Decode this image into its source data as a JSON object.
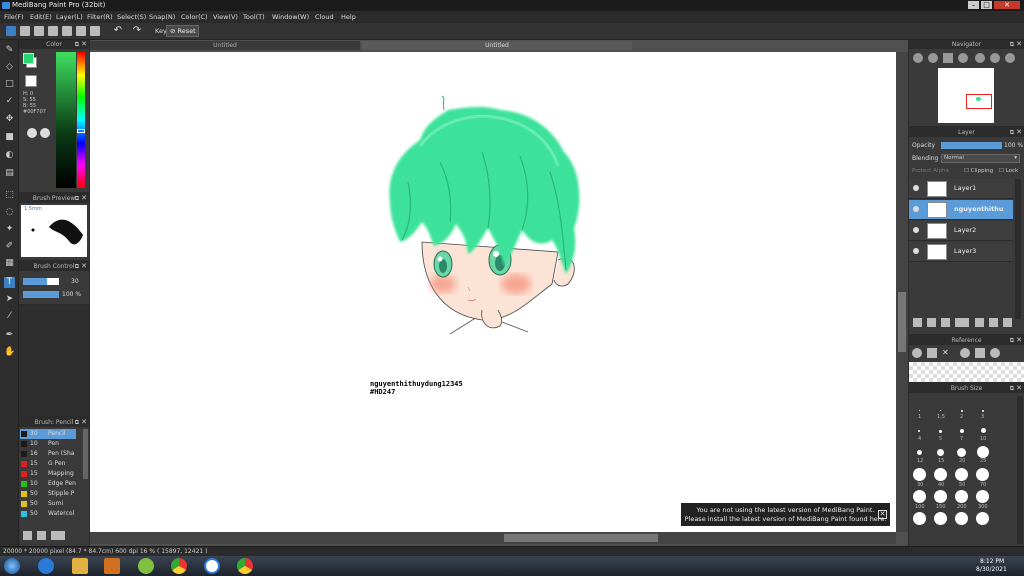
{
  "app_title": "MediBang Paint Pro (32bit)",
  "window_controls": [
    "–",
    "□",
    "✕"
  ],
  "menu": [
    "File(F)",
    "Edit(E)",
    "Layer(L)",
    "Filter(R)",
    "Select(S)",
    "Snap(N)",
    "Color(C)",
    "View(V)",
    "Tool(T)",
    "Window(W)",
    "Cloud",
    "Help"
  ],
  "toolbar": {
    "key_label": "Key",
    "reset_label": "Reset"
  },
  "doc_tabs": [
    "Untitled",
    "Untitled"
  ],
  "color_panel": {
    "title": "Color",
    "values": [
      "H: 0",
      "S: 55",
      "B: 55",
      "#00F707"
    ],
    "fg": "#26d96f",
    "bg": "#ffffff"
  },
  "brush_preview": {
    "title": "Brush Preview",
    "size_text": "1.5mm"
  },
  "brush_control": {
    "title": "Brush Control",
    "size_value": "30",
    "opacity_value": "100 %"
  },
  "brush_panel": {
    "title": "Brush: Pencil",
    "items": [
      {
        "size": "30",
        "name": "Pencil",
        "color": "#1b1b1b"
      },
      {
        "size": "10",
        "name": "Pen",
        "color": "#1b1b1b"
      },
      {
        "size": "16",
        "name": "Pen (Sha",
        "color": "#1b1b1b"
      },
      {
        "size": "15",
        "name": "G Pen",
        "color": "#e02020"
      },
      {
        "size": "15",
        "name": "Mapping",
        "color": "#e02020"
      },
      {
        "size": "10",
        "name": "Edge Pen",
        "color": "#25c020"
      },
      {
        "size": "50",
        "name": "Stipple P",
        "color": "#e0c020"
      },
      {
        "size": "50",
        "name": "Sumi",
        "color": "#e0c020"
      },
      {
        "size": "50",
        "name": "Watercol",
        "color": "#30c0e0"
      }
    ]
  },
  "navigator": {
    "title": "Navigator"
  },
  "layer_panel": {
    "title": "Layer",
    "opacity_label": "Opacity",
    "opacity_value": "100 %",
    "blending_label": "Blending",
    "blending_value": "Normal",
    "protect_alpha": "Protect Alpha",
    "clipping": "Clipping",
    "lock": "Lock",
    "layers": [
      "Layer1",
      "nguyenthithu",
      "Layer2",
      "Layer3"
    ]
  },
  "reference": {
    "title": "Reference"
  },
  "brush_size": {
    "title": "Brush Size",
    "labels": [
      "1",
      "1.5",
      "2",
      "3",
      "4",
      "5",
      "7",
      "10",
      "12",
      "15",
      "20",
      "25",
      "30",
      "40",
      "50",
      "70",
      "100",
      "150",
      "200",
      "300"
    ]
  },
  "canvas": {
    "signature_line1": "nguyenthithuydung12345",
    "signature_line2": "#HD247"
  },
  "notice": {
    "line1": "You are not using the latest version of MediBang Paint.",
    "line2": "Please install the latest version of MediBang Paint found here."
  },
  "status": "20000 * 20000 pixel  (84.7 * 84.7cm)  600 dpi  16 %  ( 15897, 12421 )",
  "tray": {
    "time": "8:12 PM",
    "date": "8/30/2021"
  },
  "colors": {
    "accent": "#5b9bd8",
    "hair": "#3ee29a"
  }
}
